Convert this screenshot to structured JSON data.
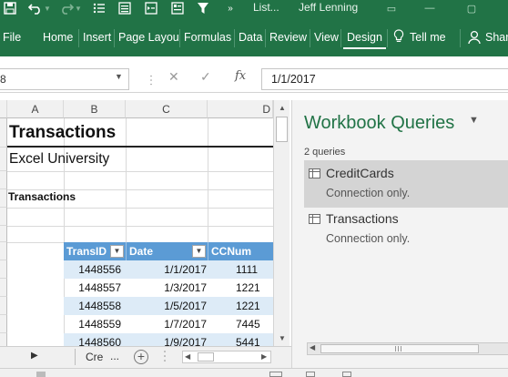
{
  "title_bar": {
    "doc_title": "List...",
    "user_name": "Jeff Lenning"
  },
  "ribbon": {
    "tabs": [
      {
        "label": "File"
      },
      {
        "label": "Home"
      },
      {
        "label": "Insert"
      },
      {
        "label": "Page Layou"
      },
      {
        "label": "Formulas"
      },
      {
        "label": "Data"
      },
      {
        "label": "Review"
      },
      {
        "label": "View"
      },
      {
        "label": "Design"
      }
    ],
    "tell_me": "Tell me",
    "share": "Shar"
  },
  "formula_bar": {
    "name_box": "8",
    "fx": "fx",
    "value": "1/1/2017"
  },
  "grid": {
    "columns": [
      "A",
      "B",
      "C",
      "D"
    ],
    "title": "Transactions",
    "subtitle": "Excel University",
    "section_label": "Transactions",
    "table": {
      "headers": [
        "TransID",
        "Date",
        "CCNum"
      ],
      "rows": [
        [
          "1448556",
          "1/1/2017",
          "1111"
        ],
        [
          "1448557",
          "1/3/2017",
          "1221"
        ],
        [
          "1448558",
          "1/5/2017",
          "1221"
        ],
        [
          "1448559",
          "1/7/2017",
          "7445"
        ],
        [
          "1448560",
          "1/9/2017",
          "5441"
        ]
      ]
    }
  },
  "sheet_tabs": {
    "current": "Cre",
    "more": "..."
  },
  "queries_pane": {
    "title": "Workbook Queries",
    "count": "2 queries",
    "items": [
      {
        "name": "CreditCards",
        "status": "Connection only.",
        "selected": true
      },
      {
        "name": "Transactions",
        "status": "Connection only.",
        "selected": false
      }
    ]
  }
}
